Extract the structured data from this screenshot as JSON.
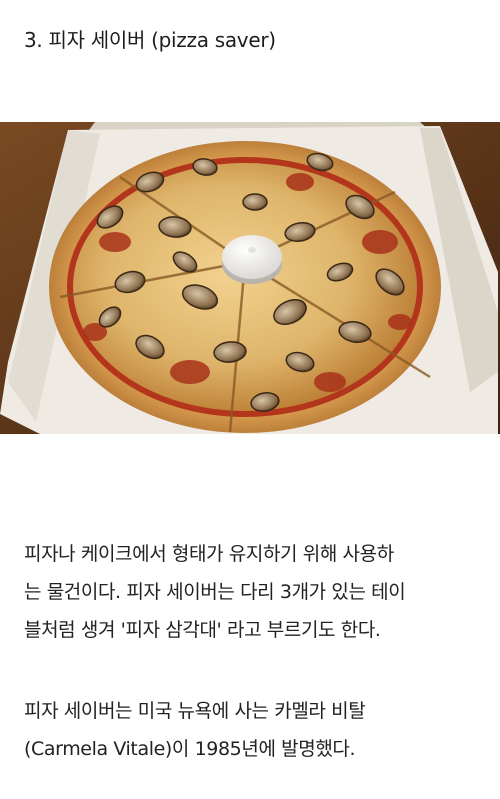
{
  "heading": "3. 피자 세이버 (pizza saver)",
  "image": {
    "subject": "pizza-in-box-with-pizza-saver"
  },
  "paragraph1": {
    "lines": [
      "피자나 케이크에서 형태가 유지하기 위해 사용하",
      "는 물건이다. 피자 세이버는 다리 3개가 있는 테이",
      "블처럼 생겨 '피자 삼각대' 라고 부르기도 한다."
    ]
  },
  "paragraph2": {
    "lines": [
      "피자 세이버는 미국 뉴욕에 사는 카멜라 비탈",
      "(Carmela Vitale)이 1985년에 발명했다."
    ]
  },
  "colors": {
    "background": "#ffffff",
    "text": "#222222",
    "crust": "#c98a3c",
    "cheese": "#e8c17a",
    "sauce": "#b3361c",
    "box": "#eeeae2",
    "table": "#5a3418"
  }
}
